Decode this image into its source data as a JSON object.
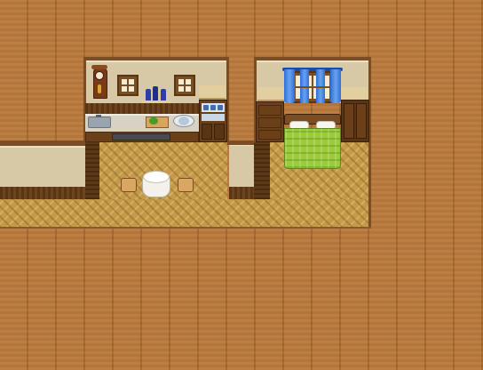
{
  "scene": {
    "type": "rpg-interior-map",
    "rooms": [
      "kitchen",
      "bedroom",
      "west-hallway"
    ],
    "furniture": [
      "wall-clock",
      "window",
      "wine-bottles",
      "sink",
      "cutting-board",
      "plate-rack",
      "dish-cupboard",
      "round-table",
      "stool",
      "dresser",
      "wardrobe",
      "bed",
      "curtains"
    ]
  },
  "colors": {
    "void": "#b87a3e",
    "floor": "#c49a4a",
    "wall": "#d8c9a6",
    "wood_dark": "#5a3514",
    "bed_green": "#9ccc3c",
    "curtain_blue": "#2d6fd6",
    "bottle_blue": "#2a3fa8"
  }
}
